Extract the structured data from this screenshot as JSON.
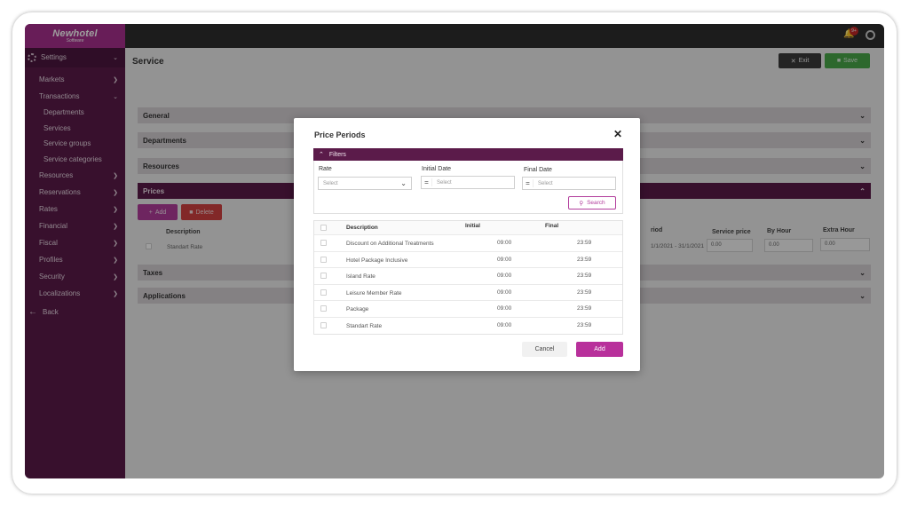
{
  "app": {
    "brand": "Newhotel",
    "brand_sub": "Software",
    "notification_count": "9+"
  },
  "sidebar": {
    "settings_label": "Settings",
    "items": [
      {
        "label": "Markets"
      },
      {
        "label": "Transactions"
      },
      {
        "label": "Departments"
      },
      {
        "label": "Services"
      },
      {
        "label": "Service groups"
      },
      {
        "label": "Service categories"
      },
      {
        "label": "Resources"
      },
      {
        "label": "Reservations"
      },
      {
        "label": "Rates"
      },
      {
        "label": "Financial"
      },
      {
        "label": "Fiscal"
      },
      {
        "label": "Profiles"
      },
      {
        "label": "Security"
      },
      {
        "label": "Localizations"
      }
    ],
    "back_label": "Back"
  },
  "page": {
    "title": "Service",
    "exit_label": "Exit",
    "save_label": "Save",
    "sections": {
      "general": "General",
      "departments": "Departments",
      "resources": "Resources",
      "prices": "Prices",
      "taxes": "Taxes",
      "applications": "Applications"
    },
    "prices": {
      "add_label": "Add",
      "delete_label": "Delete",
      "col_description": "Description",
      "col_period": "riod",
      "col_service_price": "Service price",
      "col_by_hour": "By Hour",
      "col_extra_hour": "Extra Hour",
      "row_description": "Standart Rate",
      "row_period": "1/1/2021 - 31/1/2021",
      "row_service_price": "0.00",
      "row_by_hour": "0.00",
      "row_extra_hour": "0.00"
    }
  },
  "modal": {
    "title": "Price Periods",
    "filters_label": "Filters",
    "rate_label": "Rate",
    "rate_placeholder": "Select",
    "initial_date_label": "Initial Date",
    "initial_date_placeholder": "Select",
    "final_date_label": "Final Date",
    "final_date_placeholder": "Select",
    "search_label": "Search",
    "columns": {
      "description": "Description",
      "initial": "Initial",
      "final": "Final"
    },
    "rows": [
      {
        "description": "Discount on Additional Treatments",
        "initial": "09:00",
        "final": "23:59"
      },
      {
        "description": "Hotel Package Inclusive",
        "initial": "09:00",
        "final": "23:59"
      },
      {
        "description": "Island Rate",
        "initial": "09:00",
        "final": "23:59"
      },
      {
        "description": "Leisure Member Rate",
        "initial": "09:00",
        "final": "23:59"
      },
      {
        "description": "Package",
        "initial": "09:00",
        "final": "23:59"
      },
      {
        "description": "Standart Rate",
        "initial": "09:00",
        "final": "23:59"
      }
    ],
    "cancel_label": "Cancel",
    "add_label": "Add"
  },
  "colors": {
    "sidebar": "#5b1b4a",
    "accent": "#b8309b",
    "save_green": "#49a84a",
    "delete_red": "#d24141"
  }
}
